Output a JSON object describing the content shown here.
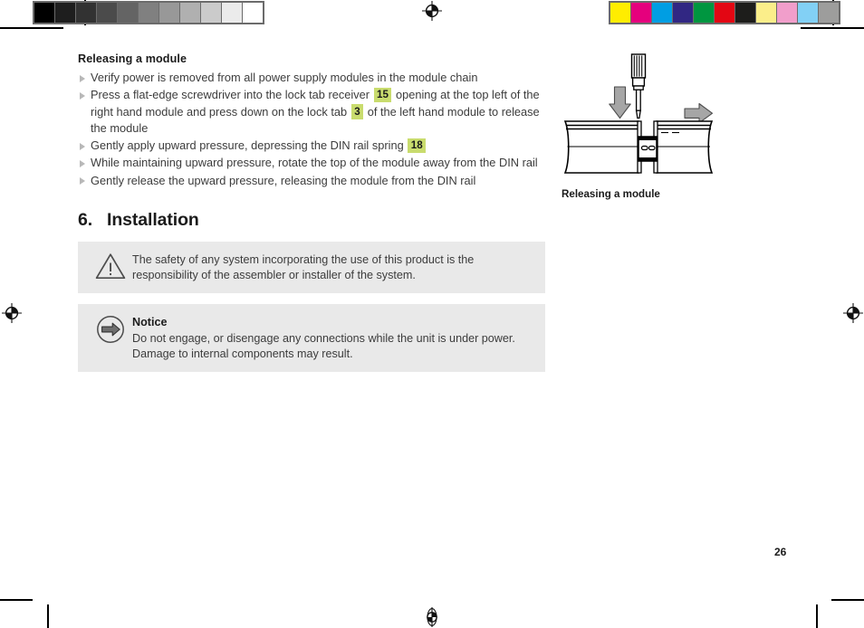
{
  "document": {
    "page_number": "26"
  },
  "release_section": {
    "heading": "Releasing a module",
    "steps": [
      {
        "parts": [
          {
            "type": "text",
            "value": "Verify power is removed from all power supply modules in the module chain"
          }
        ]
      },
      {
        "parts": [
          {
            "type": "text",
            "value": "Press a flat-edge screwdriver into the lock tab receiver "
          },
          {
            "type": "badge",
            "value": "15"
          },
          {
            "type": "text",
            "value": " opening at the top left of the right hand module and press down on the lock tab "
          },
          {
            "type": "badge",
            "value": "3"
          },
          {
            "type": "text",
            "value": " of the left hand module to release the module"
          }
        ]
      },
      {
        "parts": [
          {
            "type": "text",
            "value": "Gently apply upward pressure, depressing the DIN rail spring "
          },
          {
            "type": "badge",
            "value": "18"
          }
        ]
      },
      {
        "parts": [
          {
            "type": "text",
            "value": "While maintaining upward pressure, rotate the top of the module away from the DIN rail"
          }
        ]
      },
      {
        "parts": [
          {
            "type": "text",
            "value": "Gently release the upward pressure, releasing the module from the DIN rail"
          }
        ]
      }
    ]
  },
  "chapter": {
    "number": "6.",
    "title": "Installation"
  },
  "notes": [
    {
      "icon": "warning-triangle-icon",
      "title": "",
      "text": "The safety of any system incorporating the use of this product is the responsibility of the assembler or installer of the system."
    },
    {
      "icon": "notice-arrow-icon",
      "title": "Notice",
      "text": "Do not engage, or disengage any connections while the unit is under power. Damage to internal components may result."
    }
  ],
  "figure": {
    "caption": "Releasing a module",
    "alt": "Two DIN rail modules with a screwdriver pressing down into the lock tab receiver and an arrow showing the right hand module sliding away"
  },
  "print_marks": {
    "grey_strip": [
      "#000000",
      "#1e1e1e",
      "#323232",
      "#4b4b4b",
      "#646464",
      "#808080",
      "#989898",
      "#b0b0b0",
      "#cbcbcb",
      "#ebebeb",
      "#ffffff"
    ],
    "color_strip": [
      "#ffed00",
      "#e5007d",
      "#009ee3",
      "#312783",
      "#009640",
      "#e30613",
      "#1d1d1b",
      "#fbee8a",
      "#f19ecb",
      "#82d0f5",
      "#9d9d9c"
    ],
    "registration_icon": "registration-target-icon"
  },
  "accent_colors": {
    "badge_bg": "#c9dc6e",
    "note_bg": "#e9e9e9",
    "body_text": "#3c3c3c",
    "heading_text": "#1b1b1b",
    "bullet_triangle": "#b8b8b8"
  }
}
